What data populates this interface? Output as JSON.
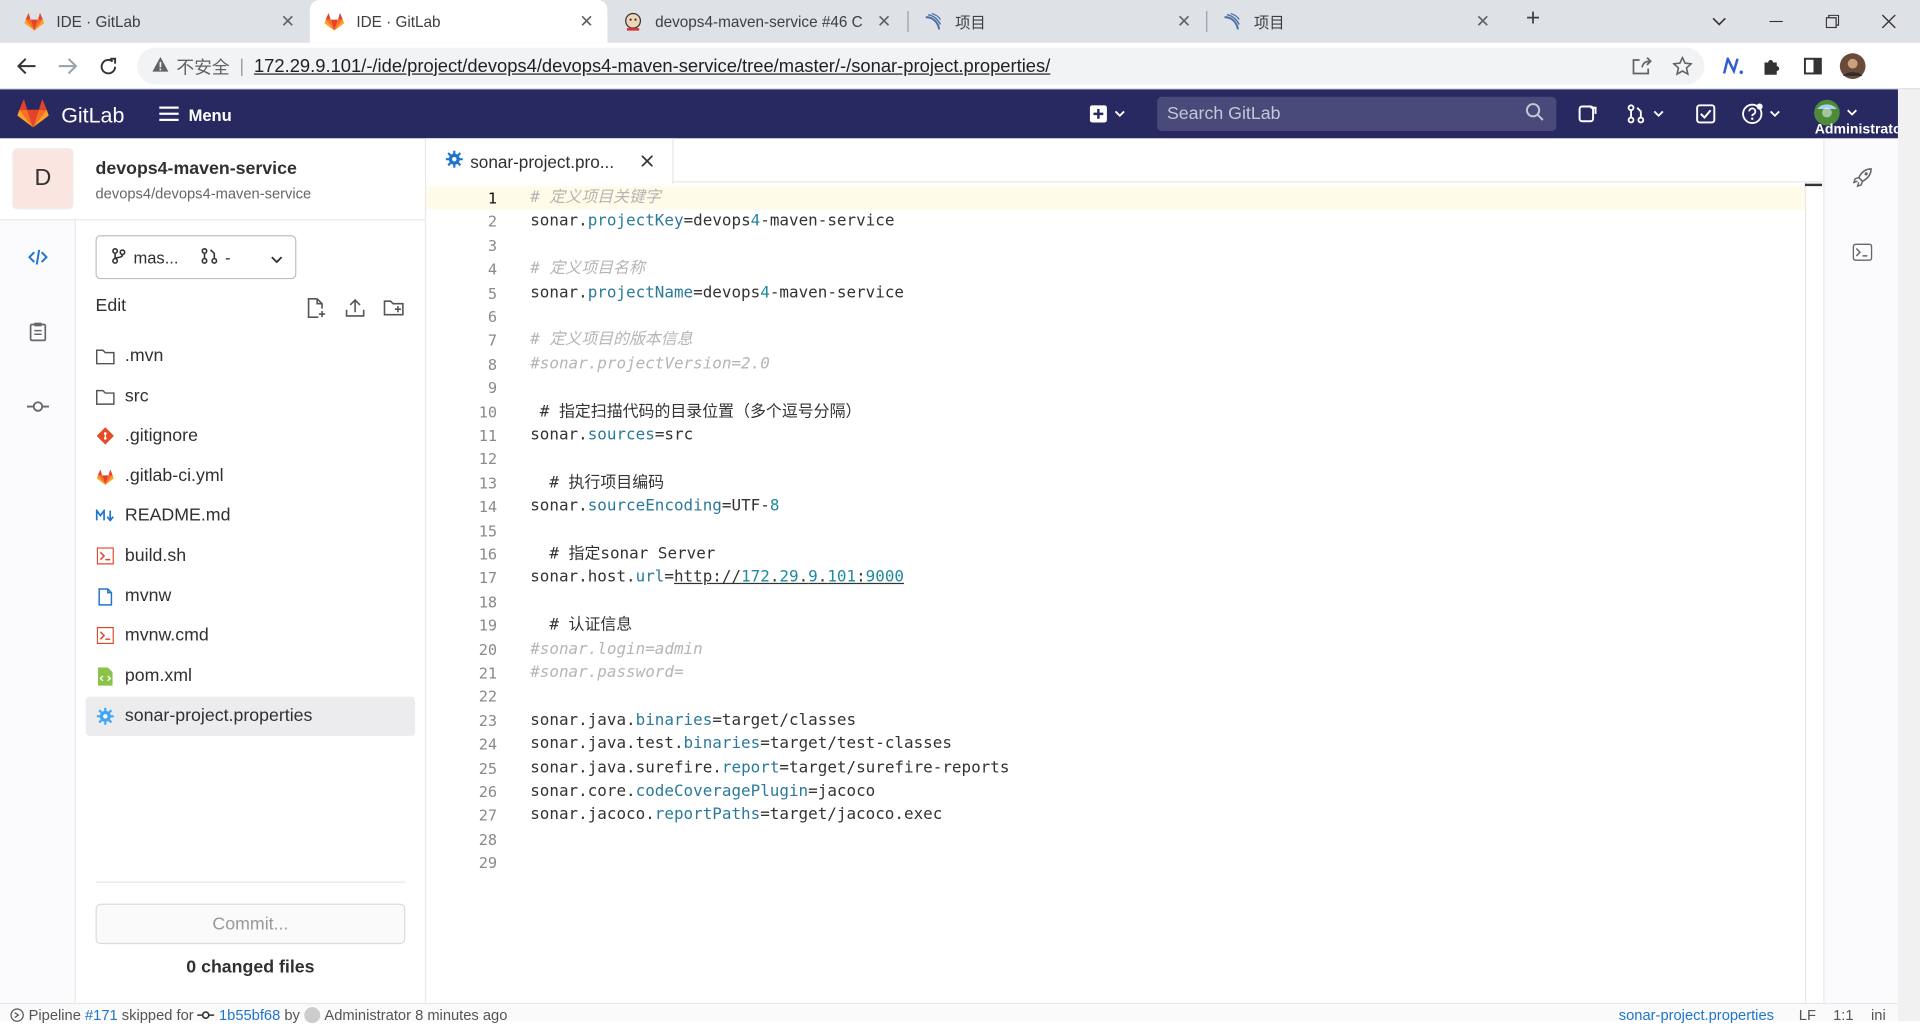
{
  "browser": {
    "tabs": [
      {
        "title": "IDE · GitLab",
        "icon": "gitlab-icon",
        "active": false
      },
      {
        "title": "IDE · GitLab",
        "icon": "gitlab-icon",
        "active": true
      },
      {
        "title": "devops4-maven-service #46 C",
        "icon": "jenkins-icon",
        "active": false
      },
      {
        "title": "项目",
        "icon": "sonarqube-icon",
        "active": false
      },
      {
        "title": "项目",
        "icon": "sonarqube-icon",
        "active": false
      }
    ],
    "insecure_label": "不安全",
    "url": "172.29.9.101/-/ide/project/devops4/devops4-maven-service/tree/master/-/sonar-project.properties/",
    "new_tab": "+",
    "close_glyph": "✕"
  },
  "gitlab_header": {
    "brand": "GitLab",
    "menu_label": "Menu",
    "search_placeholder": "Search GitLab",
    "user_label": "Administrator"
  },
  "project": {
    "avatar_letter": "D",
    "name": "devops4-maven-service",
    "path": "devops4/devops4-maven-service"
  },
  "tree": {
    "branch": "mas...",
    "mr": "-",
    "edit_label": "Edit",
    "files": [
      {
        "name": ".mvn",
        "type": "folder"
      },
      {
        "name": "src",
        "type": "folder"
      },
      {
        "name": ".gitignore",
        "type": "git"
      },
      {
        "name": ".gitlab-ci.yml",
        "type": "gitlab"
      },
      {
        "name": "README.md",
        "type": "markdown"
      },
      {
        "name": "build.sh",
        "type": "shell"
      },
      {
        "name": "mvnw",
        "type": "file"
      },
      {
        "name": "mvnw.cmd",
        "type": "shell"
      },
      {
        "name": "pom.xml",
        "type": "xml"
      },
      {
        "name": "sonar-project.properties",
        "type": "settings",
        "active": true
      }
    ],
    "commit_label": "Commit...",
    "changed_files": "0 changed files"
  },
  "editor": {
    "tab_title": "sonar-project.pro...",
    "lines": [
      "# 定义项目关键字",
      "sonar.projectKey=devops4-maven-service",
      "",
      "# 定义项目名称",
      "sonar.projectName=devops4-maven-service",
      "",
      "# 定义项目的版本信息",
      "#sonar.projectVersion=2.0",
      "",
      " # 指定扫描代码的目录位置（多个逗号分隔）",
      "sonar.sources=src",
      "",
      "  # 执行项目编码",
      "sonar.sourceEncoding=UTF-8",
      "",
      "  # 指定sonar Server",
      "sonar.host.url=http://172.29.9.101:9000",
      "",
      "  # 认证信息",
      "#sonar.login=admin",
      "#sonar.password=",
      "",
      "sonar.java.binaries=target/classes",
      "sonar.java.test.binaries=target/test-classes",
      "sonar.java.surefire.report=target/surefire-reports",
      "sonar.core.codeCoveragePlugin=jacoco",
      "sonar.jacoco.reportPaths=target/jacoco.exec",
      "",
      ""
    ],
    "current_line": 1
  },
  "status_bar": {
    "pipeline_prefix": "Pipeline",
    "pipeline_id": "#171",
    "pipeline_state": "skipped for",
    "commit_sha": "1b55bf68",
    "by": "by",
    "author": "Administrator",
    "time": "8 minutes ago",
    "file": "sonar-project.properties",
    "eol": "LF",
    "position": "1:1",
    "lang": "ini"
  }
}
